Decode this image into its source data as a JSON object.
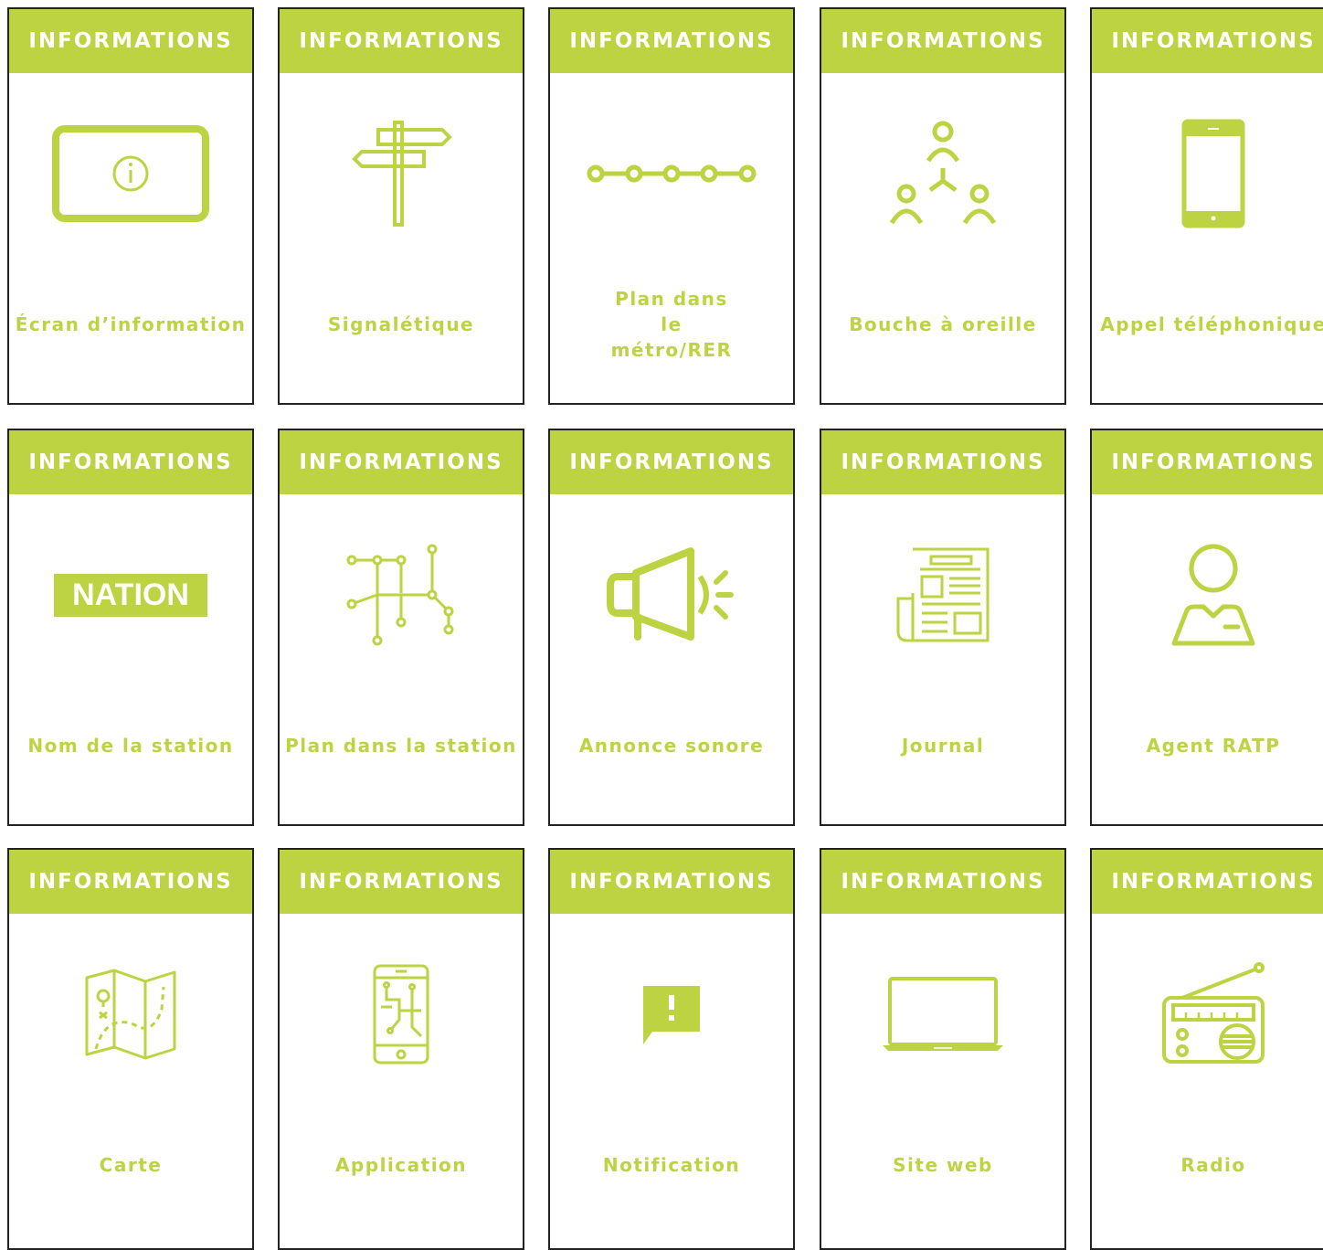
{
  "colors": {
    "accent": "#bed342",
    "border": "#222222",
    "header_text": "#ffffff"
  },
  "cards": [
    {
      "header": "INFORMATIONS",
      "label": "Écran d’information",
      "icon": "info-screen-icon"
    },
    {
      "header": "INFORMATIONS",
      "label": "Signalétique",
      "icon": "signpost-icon"
    },
    {
      "header": "INFORMATIONS",
      "label": "Plan dans le métro/RER",
      "icon": "metro-line-icon"
    },
    {
      "header": "INFORMATIONS",
      "label": "Bouche à oreille",
      "icon": "people-network-icon"
    },
    {
      "header": "INFORMATIONS",
      "label": "Appel téléphonique",
      "icon": "smartphone-icon"
    },
    {
      "header": "INFORMATIONS",
      "label": "Nom de la station",
      "icon": "station-name-sign",
      "sign_text": "NATION"
    },
    {
      "header": "INFORMATIONS",
      "label": "Plan dans la station",
      "icon": "station-map-icon"
    },
    {
      "header": "INFORMATIONS",
      "label": "Annonce sonore",
      "icon": "megaphone-icon"
    },
    {
      "header": "INFORMATIONS",
      "label": "Journal",
      "icon": "newspaper-icon"
    },
    {
      "header": "INFORMATIONS",
      "label": "Agent RATP",
      "icon": "agent-icon"
    },
    {
      "header": "INFORMATIONS",
      "label": "Carte",
      "icon": "map-icon"
    },
    {
      "header": "INFORMATIONS",
      "label": "Application",
      "icon": "app-icon"
    },
    {
      "header": "INFORMATIONS",
      "label": "Notification",
      "icon": "notification-icon"
    },
    {
      "header": "INFORMATIONS",
      "label": "Site web",
      "icon": "laptop-icon"
    },
    {
      "header": "INFORMATIONS",
      "label": "Radio",
      "icon": "radio-icon"
    }
  ]
}
